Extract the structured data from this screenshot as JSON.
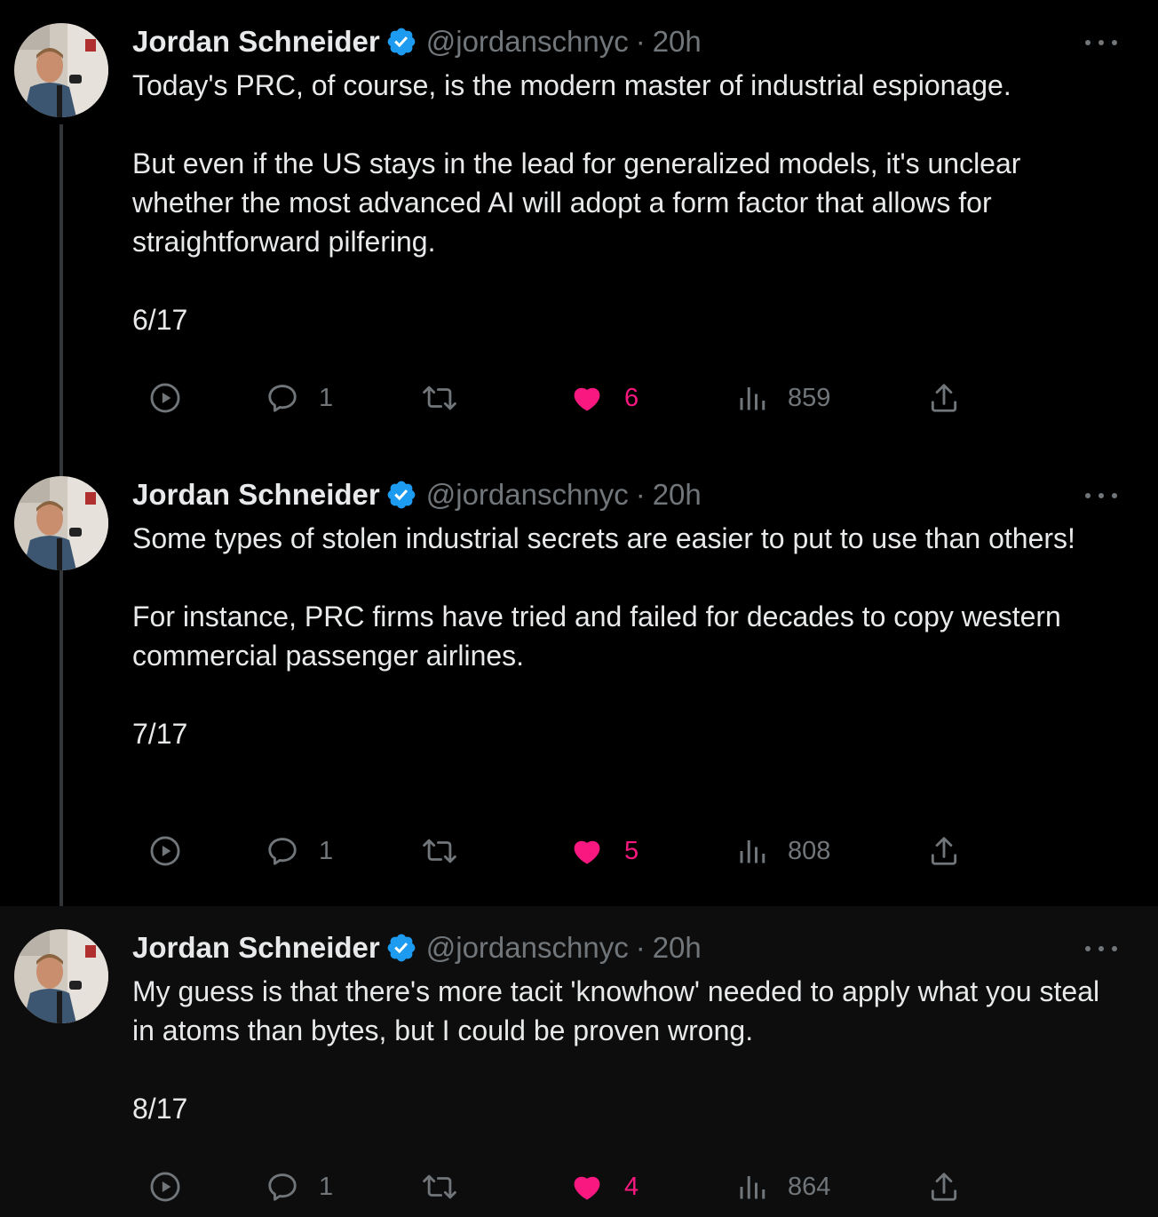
{
  "colors": {
    "background": "#000000",
    "text": "#e7e9ea",
    "muted": "#71767b",
    "like": "#f91880",
    "verified": "#1d9bf0"
  },
  "tweets": [
    {
      "author": "Jordan Schneider",
      "handle": "@jordanschnyc",
      "separator": "·",
      "time": "20h",
      "paragraphs": [
        "Today's PRC, of course, is the modern master of industrial espionage.",
        "But even if the US stays in the lead for generalized models, it's unclear whether the most advanced AI will adopt a form factor that allows for straightforward pilfering.",
        "6/17"
      ],
      "replies": "1",
      "retweets": "",
      "likes": "6",
      "views": "859"
    },
    {
      "author": "Jordan Schneider",
      "handle": "@jordanschnyc",
      "separator": "·",
      "time": "20h",
      "paragraphs": [
        "Some types of stolen industrial secrets are easier to put to use than others!",
        "For instance, PRC firms have tried and failed for decades to copy western commercial passenger airlines.",
        "7/17"
      ],
      "replies": "1",
      "retweets": "",
      "likes": "5",
      "views": "808"
    },
    {
      "author": "Jordan Schneider",
      "handle": "@jordanschnyc",
      "separator": "·",
      "time": "20h",
      "paragraphs": [
        "My guess is that there's more tacit 'knowhow' needed to apply what you steal in atoms than bytes, but I could be proven wrong.",
        "8/17"
      ],
      "replies": "1",
      "retweets": "",
      "likes": "4",
      "views": "864"
    }
  ],
  "icons": {
    "play": "play-circle-icon",
    "reply": "reply-icon",
    "retweet": "retweet-icon",
    "like": "heart-icon",
    "views": "views-icon",
    "share": "share-icon",
    "more": "more-icon",
    "verified": "verified-badge-icon"
  }
}
